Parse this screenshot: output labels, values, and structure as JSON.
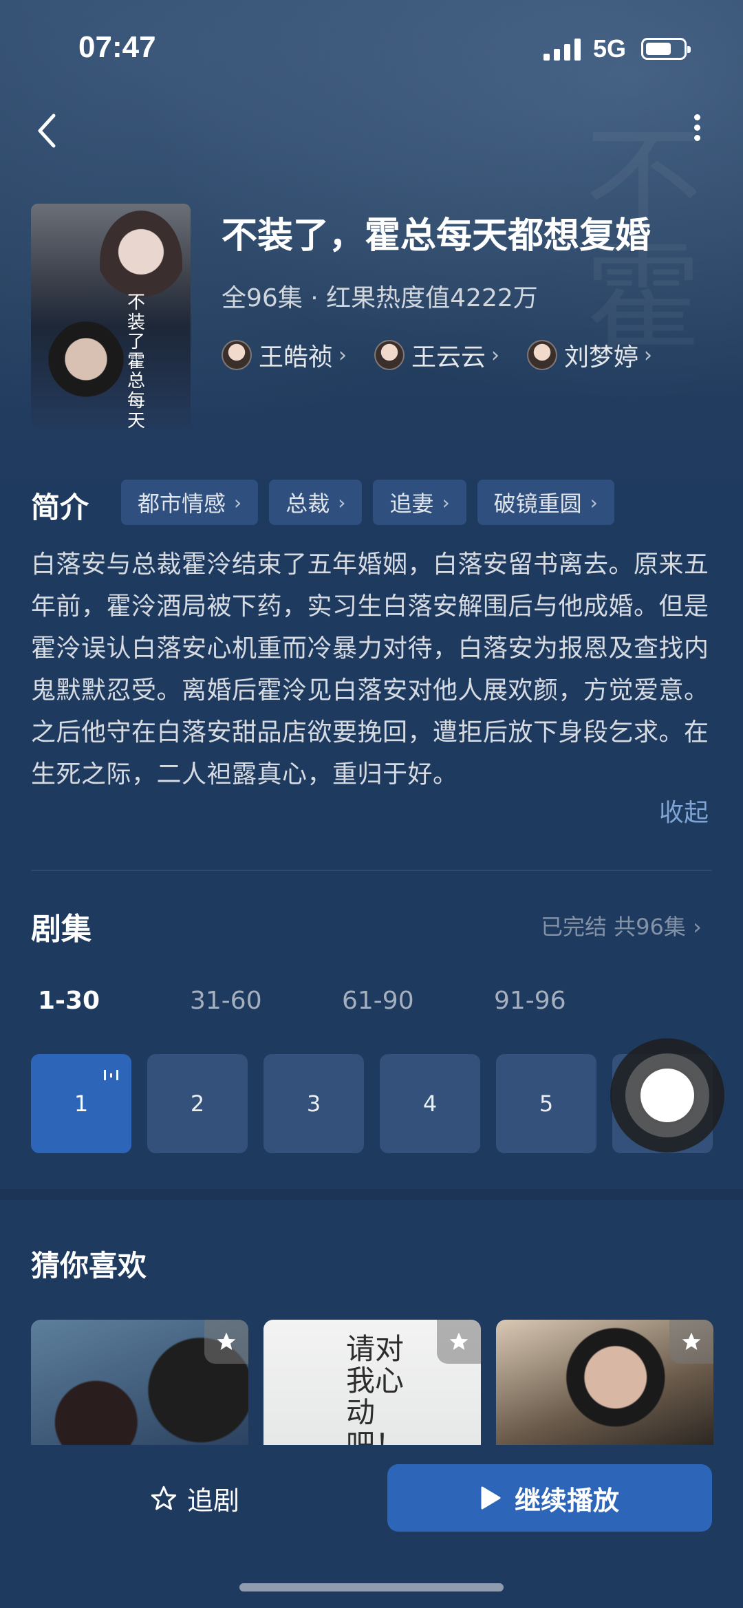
{
  "status_bar": {
    "time": "07:47",
    "network": "5G"
  },
  "drama": {
    "title": "不装了，霍总每天都想复婚",
    "meta": "全96集 · 红果热度值4222万",
    "poster_title": "不装了霍总每天都想复婚",
    "cast": [
      {
        "name": "王皓祯"
      },
      {
        "name": "王云云"
      },
      {
        "name": "刘梦婷"
      }
    ]
  },
  "intro": {
    "label": "简介",
    "tags": [
      "都市情感",
      "总裁",
      "追妻",
      "破镜重圆"
    ],
    "description": "白落安与总裁霍泠结束了五年婚姻，白落安留书离去。原来五年前，霍泠酒局被下药，实习生白落安解围后与他成婚。但是霍泠误认白落安心机重而冷暴力对待，白落安为报恩及查找内鬼默默忍受。离婚后霍泠见白落安对他人展欢颜，方觉爱意。之后他守在白落安甜品店欲要挽回，遭拒后放下身段乞求。在生死之际，二人袒露真心，重归于好。",
    "collapse_label": "收起"
  },
  "episodes": {
    "title": "剧集",
    "status": "已完结 共96集",
    "ranges": [
      "1-30",
      "31-60",
      "61-90",
      "91-96"
    ],
    "active_range": 0,
    "items": [
      "1",
      "2",
      "3",
      "4",
      "5"
    ],
    "current": "1"
  },
  "recommend": {
    "title": "猜你喜欢",
    "items": [
      {
        "cover_text": ""
      },
      {
        "cover_text": "请对我心动吧！"
      },
      {
        "cover_text": ""
      }
    ]
  },
  "bottom": {
    "follow_label": "追剧",
    "play_label": "继续播放"
  },
  "colors": {
    "background": "#1f3a5f",
    "accent": "#2d66b8",
    "tag_bg": "#2f4f7e",
    "link": "#7fa4d6"
  }
}
